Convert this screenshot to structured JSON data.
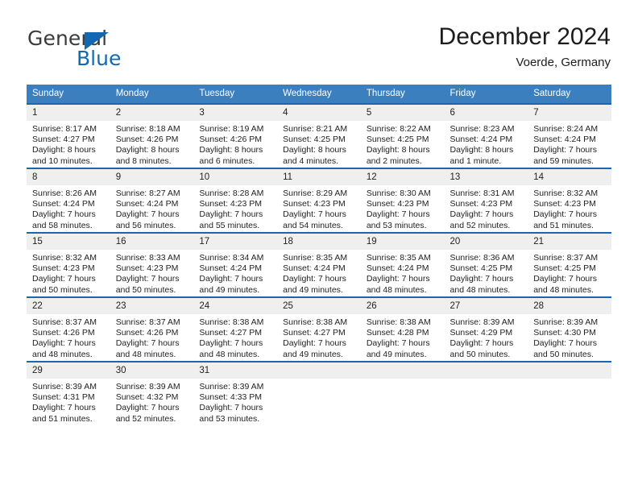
{
  "brand": {
    "name_part1": "General",
    "name_part2": "Blue",
    "accent_color": "#1268b3"
  },
  "header": {
    "title": "December 2024",
    "subtitle": "Voerde, Germany"
  },
  "calendar": {
    "header_color": "#3b7fbf",
    "row_divider_color": "#1d66ad",
    "daynum_background": "#efefef",
    "weekday_headers": [
      "Sunday",
      "Monday",
      "Tuesday",
      "Wednesday",
      "Thursday",
      "Friday",
      "Saturday"
    ],
    "weeks": [
      [
        {
          "day": "1",
          "sunrise": "Sunrise: 8:17 AM",
          "sunset": "Sunset: 4:27 PM",
          "daylight_line1": "Daylight: 8 hours",
          "daylight_line2": "and 10 minutes."
        },
        {
          "day": "2",
          "sunrise": "Sunrise: 8:18 AM",
          "sunset": "Sunset: 4:26 PM",
          "daylight_line1": "Daylight: 8 hours",
          "daylight_line2": "and 8 minutes."
        },
        {
          "day": "3",
          "sunrise": "Sunrise: 8:19 AM",
          "sunset": "Sunset: 4:26 PM",
          "daylight_line1": "Daylight: 8 hours",
          "daylight_line2": "and 6 minutes."
        },
        {
          "day": "4",
          "sunrise": "Sunrise: 8:21 AM",
          "sunset": "Sunset: 4:25 PM",
          "daylight_line1": "Daylight: 8 hours",
          "daylight_line2": "and 4 minutes."
        },
        {
          "day": "5",
          "sunrise": "Sunrise: 8:22 AM",
          "sunset": "Sunset: 4:25 PM",
          "daylight_line1": "Daylight: 8 hours",
          "daylight_line2": "and 2 minutes."
        },
        {
          "day": "6",
          "sunrise": "Sunrise: 8:23 AM",
          "sunset": "Sunset: 4:24 PM",
          "daylight_line1": "Daylight: 8 hours",
          "daylight_line2": "and 1 minute."
        },
        {
          "day": "7",
          "sunrise": "Sunrise: 8:24 AM",
          "sunset": "Sunset: 4:24 PM",
          "daylight_line1": "Daylight: 7 hours",
          "daylight_line2": "and 59 minutes."
        }
      ],
      [
        {
          "day": "8",
          "sunrise": "Sunrise: 8:26 AM",
          "sunset": "Sunset: 4:24 PM",
          "daylight_line1": "Daylight: 7 hours",
          "daylight_line2": "and 58 minutes."
        },
        {
          "day": "9",
          "sunrise": "Sunrise: 8:27 AM",
          "sunset": "Sunset: 4:24 PM",
          "daylight_line1": "Daylight: 7 hours",
          "daylight_line2": "and 56 minutes."
        },
        {
          "day": "10",
          "sunrise": "Sunrise: 8:28 AM",
          "sunset": "Sunset: 4:23 PM",
          "daylight_line1": "Daylight: 7 hours",
          "daylight_line2": "and 55 minutes."
        },
        {
          "day": "11",
          "sunrise": "Sunrise: 8:29 AM",
          "sunset": "Sunset: 4:23 PM",
          "daylight_line1": "Daylight: 7 hours",
          "daylight_line2": "and 54 minutes."
        },
        {
          "day": "12",
          "sunrise": "Sunrise: 8:30 AM",
          "sunset": "Sunset: 4:23 PM",
          "daylight_line1": "Daylight: 7 hours",
          "daylight_line2": "and 53 minutes."
        },
        {
          "day": "13",
          "sunrise": "Sunrise: 8:31 AM",
          "sunset": "Sunset: 4:23 PM",
          "daylight_line1": "Daylight: 7 hours",
          "daylight_line2": "and 52 minutes."
        },
        {
          "day": "14",
          "sunrise": "Sunrise: 8:32 AM",
          "sunset": "Sunset: 4:23 PM",
          "daylight_line1": "Daylight: 7 hours",
          "daylight_line2": "and 51 minutes."
        }
      ],
      [
        {
          "day": "15",
          "sunrise": "Sunrise: 8:32 AM",
          "sunset": "Sunset: 4:23 PM",
          "daylight_line1": "Daylight: 7 hours",
          "daylight_line2": "and 50 minutes."
        },
        {
          "day": "16",
          "sunrise": "Sunrise: 8:33 AM",
          "sunset": "Sunset: 4:23 PM",
          "daylight_line1": "Daylight: 7 hours",
          "daylight_line2": "and 50 minutes."
        },
        {
          "day": "17",
          "sunrise": "Sunrise: 8:34 AM",
          "sunset": "Sunset: 4:24 PM",
          "daylight_line1": "Daylight: 7 hours",
          "daylight_line2": "and 49 minutes."
        },
        {
          "day": "18",
          "sunrise": "Sunrise: 8:35 AM",
          "sunset": "Sunset: 4:24 PM",
          "daylight_line1": "Daylight: 7 hours",
          "daylight_line2": "and 49 minutes."
        },
        {
          "day": "19",
          "sunrise": "Sunrise: 8:35 AM",
          "sunset": "Sunset: 4:24 PM",
          "daylight_line1": "Daylight: 7 hours",
          "daylight_line2": "and 48 minutes."
        },
        {
          "day": "20",
          "sunrise": "Sunrise: 8:36 AM",
          "sunset": "Sunset: 4:25 PM",
          "daylight_line1": "Daylight: 7 hours",
          "daylight_line2": "and 48 minutes."
        },
        {
          "day": "21",
          "sunrise": "Sunrise: 8:37 AM",
          "sunset": "Sunset: 4:25 PM",
          "daylight_line1": "Daylight: 7 hours",
          "daylight_line2": "and 48 minutes."
        }
      ],
      [
        {
          "day": "22",
          "sunrise": "Sunrise: 8:37 AM",
          "sunset": "Sunset: 4:26 PM",
          "daylight_line1": "Daylight: 7 hours",
          "daylight_line2": "and 48 minutes."
        },
        {
          "day": "23",
          "sunrise": "Sunrise: 8:37 AM",
          "sunset": "Sunset: 4:26 PM",
          "daylight_line1": "Daylight: 7 hours",
          "daylight_line2": "and 48 minutes."
        },
        {
          "day": "24",
          "sunrise": "Sunrise: 8:38 AM",
          "sunset": "Sunset: 4:27 PM",
          "daylight_line1": "Daylight: 7 hours",
          "daylight_line2": "and 48 minutes."
        },
        {
          "day": "25",
          "sunrise": "Sunrise: 8:38 AM",
          "sunset": "Sunset: 4:27 PM",
          "daylight_line1": "Daylight: 7 hours",
          "daylight_line2": "and 49 minutes."
        },
        {
          "day": "26",
          "sunrise": "Sunrise: 8:38 AM",
          "sunset": "Sunset: 4:28 PM",
          "daylight_line1": "Daylight: 7 hours",
          "daylight_line2": "and 49 minutes."
        },
        {
          "day": "27",
          "sunrise": "Sunrise: 8:39 AM",
          "sunset": "Sunset: 4:29 PM",
          "daylight_line1": "Daylight: 7 hours",
          "daylight_line2": "and 50 minutes."
        },
        {
          "day": "28",
          "sunrise": "Sunrise: 8:39 AM",
          "sunset": "Sunset: 4:30 PM",
          "daylight_line1": "Daylight: 7 hours",
          "daylight_line2": "and 50 minutes."
        }
      ],
      [
        {
          "day": "29",
          "sunrise": "Sunrise: 8:39 AM",
          "sunset": "Sunset: 4:31 PM",
          "daylight_line1": "Daylight: 7 hours",
          "daylight_line2": "and 51 minutes."
        },
        {
          "day": "30",
          "sunrise": "Sunrise: 8:39 AM",
          "sunset": "Sunset: 4:32 PM",
          "daylight_line1": "Daylight: 7 hours",
          "daylight_line2": "and 52 minutes."
        },
        {
          "day": "31",
          "sunrise": "Sunrise: 8:39 AM",
          "sunset": "Sunset: 4:33 PM",
          "daylight_line1": "Daylight: 7 hours",
          "daylight_line2": "and 53 minutes."
        },
        {
          "day": "",
          "sunrise": "",
          "sunset": "",
          "daylight_line1": "",
          "daylight_line2": ""
        },
        {
          "day": "",
          "sunrise": "",
          "sunset": "",
          "daylight_line1": "",
          "daylight_line2": ""
        },
        {
          "day": "",
          "sunrise": "",
          "sunset": "",
          "daylight_line1": "",
          "daylight_line2": ""
        },
        {
          "day": "",
          "sunrise": "",
          "sunset": "",
          "daylight_line1": "",
          "daylight_line2": ""
        }
      ]
    ]
  }
}
